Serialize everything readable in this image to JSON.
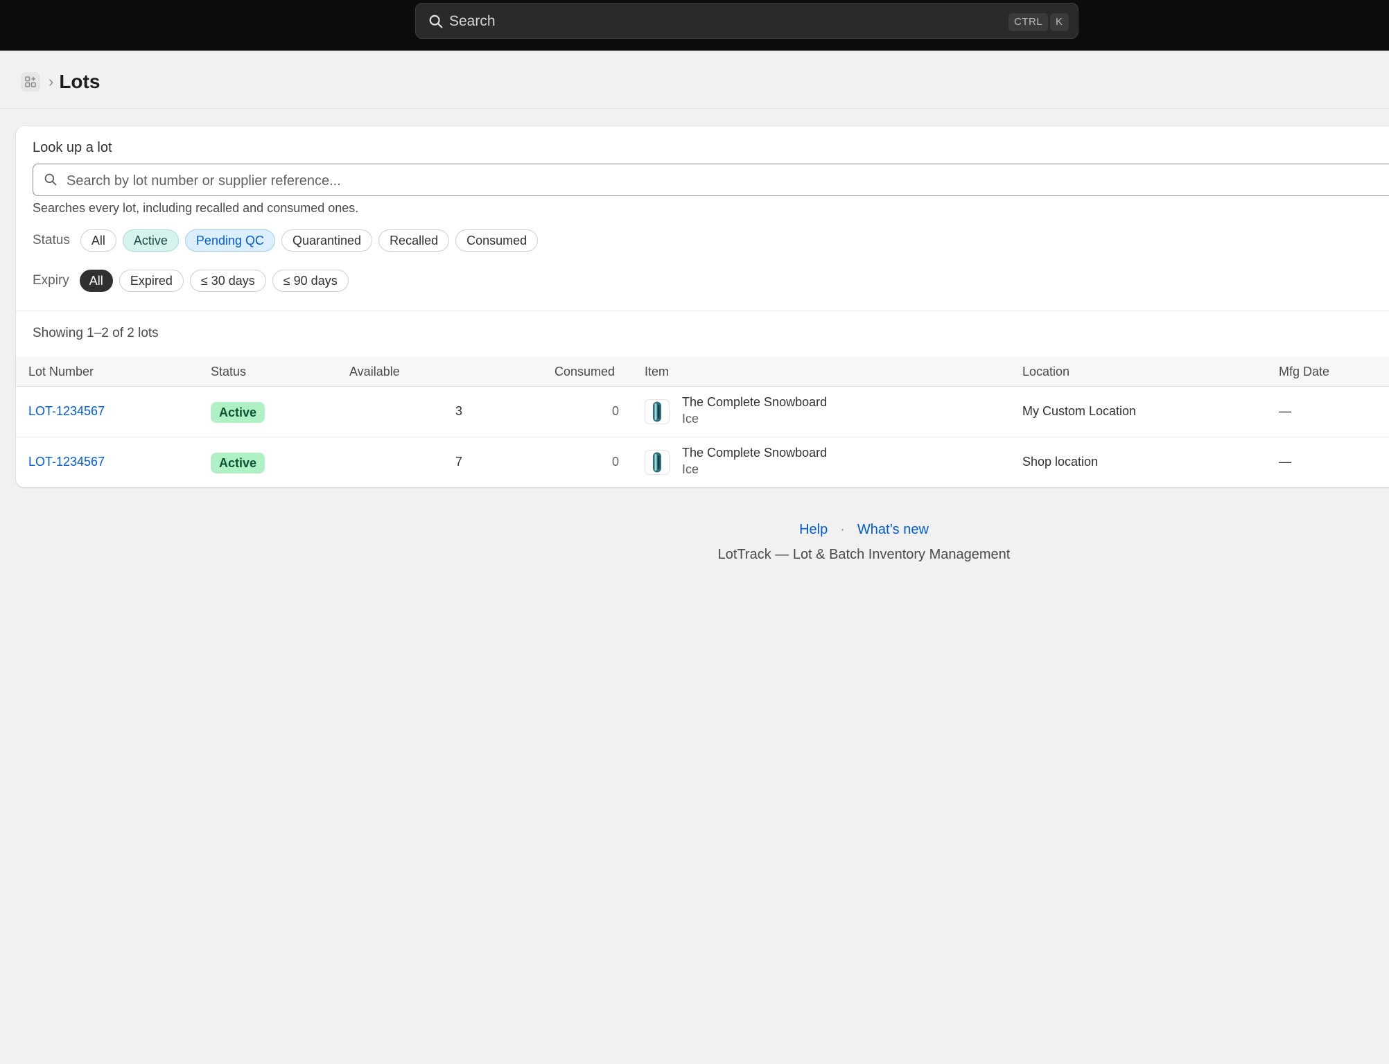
{
  "topbar": {
    "search_placeholder": "Search",
    "shortcut_ctrl": "CTRL",
    "shortcut_key": "K"
  },
  "breadcrumb": {
    "title": "Lots"
  },
  "lookup": {
    "label": "Look up a lot",
    "placeholder": "Search by lot number or supplier reference...",
    "value": "",
    "help": "Searches every lot, including recalled and consumed ones."
  },
  "filters": {
    "status_label": "Status",
    "status_options": [
      "All",
      "Active",
      "Pending QC",
      "Quarantined",
      "Recalled",
      "Consumed"
    ],
    "expiry_label": "Expiry",
    "expiry_options": [
      "All",
      "Expired",
      "≤ 30 days",
      "≤ 90 days"
    ]
  },
  "results": {
    "summary": "Showing 1–2 of 2 lots"
  },
  "table": {
    "columns": [
      "Lot Number",
      "Status",
      "Available",
      "Consumed",
      "Item",
      "Location",
      "Mfg Date"
    ],
    "rows": [
      {
        "lot": "LOT-1234567",
        "status": "Active",
        "available": "3",
        "consumed": "0",
        "item_name": "The Complete Snowboard",
        "item_variant": "Ice",
        "location": "My Custom Location",
        "mfg_date": "—"
      },
      {
        "lot": "LOT-1234567",
        "status": "Active",
        "available": "7",
        "consumed": "0",
        "item_name": "The Complete Snowboard",
        "item_variant": "Ice",
        "location": "Shop location",
        "mfg_date": "—"
      }
    ]
  },
  "footer": {
    "help": "Help",
    "separator": "·",
    "whats_new": "What’s new",
    "tagline": "LotTrack — Lot & Batch Inventory Management"
  },
  "colors": {
    "link": "#005bd3",
    "active_badge": "#aff0c5",
    "topbar": "#0c0c0c"
  }
}
